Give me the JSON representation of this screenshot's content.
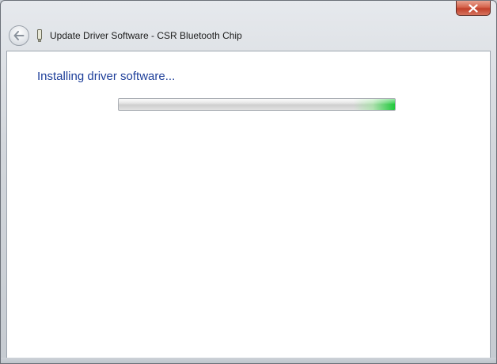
{
  "window": {
    "title": "Update Driver Software - CSR Bluetooth Chip",
    "close_icon": "close-icon",
    "back_icon": "back-arrow-icon",
    "device_icon": "device-icon"
  },
  "main": {
    "heading": "Installing driver software...",
    "progress": {
      "value": 1.0,
      "style": "marquee",
      "accent_color": "#1fc93b"
    }
  },
  "colors": {
    "heading": "#1e3f9a",
    "close_button": "#c1402a"
  }
}
